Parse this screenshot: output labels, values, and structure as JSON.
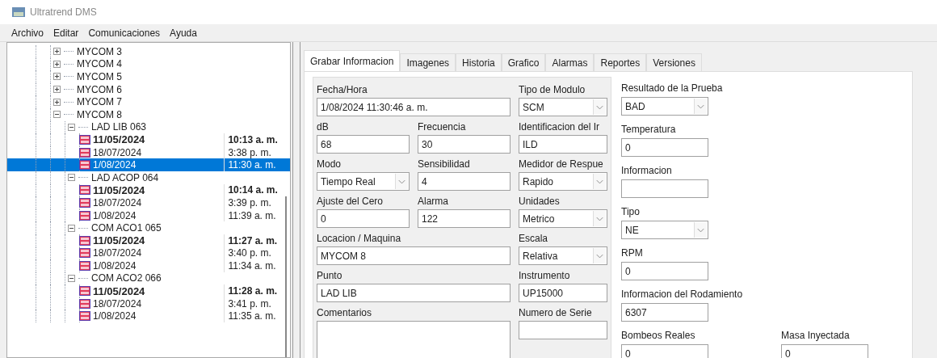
{
  "window": {
    "title": "Ultratrend DMS"
  },
  "menu": [
    "Archivo",
    "Editar",
    "Comunicaciones",
    "Ayuda"
  ],
  "tree": [
    {
      "label": "MYCOM 3",
      "expanded": false
    },
    {
      "label": "MYCOM 4",
      "expanded": false
    },
    {
      "label": "MYCOM 5",
      "expanded": false
    },
    {
      "label": "MYCOM 6",
      "expanded": false
    },
    {
      "label": "MYCOM 7",
      "expanded": false
    },
    {
      "label": "MYCOM 8",
      "expanded": true,
      "children": [
        {
          "label": "LAD LIB 063",
          "expanded": true,
          "readings": [
            {
              "date": "11/05/2024",
              "time": "10:13 a. m.",
              "bold": true,
              "selected": false
            },
            {
              "date": "18/07/2024",
              "time": "3:38 p. m.",
              "bold": false,
              "selected": false
            },
            {
              "date": "1/08/2024",
              "time": "11:30 a. m.",
              "bold": false,
              "selected": true
            }
          ]
        },
        {
          "label": "LAD ACOP 064",
          "expanded": true,
          "readings": [
            {
              "date": "11/05/2024",
              "time": "10:14 a. m.",
              "bold": true,
              "selected": false
            },
            {
              "date": "18/07/2024",
              "time": "3:39 p. m.",
              "bold": false,
              "selected": false
            },
            {
              "date": "1/08/2024",
              "time": "11:39 a. m.",
              "bold": false,
              "selected": false
            }
          ]
        },
        {
          "label": "COM ACO1 065",
          "expanded": true,
          "readings": [
            {
              "date": "11/05/2024",
              "time": "11:27 a. m.",
              "bold": true,
              "selected": false
            },
            {
              "date": "18/07/2024",
              "time": "3:40 p. m.",
              "bold": false,
              "selected": false
            },
            {
              "date": "1/08/2024",
              "time": "11:34 a. m.",
              "bold": false,
              "selected": false
            }
          ]
        },
        {
          "label": "COM ACO2 066",
          "expanded": true,
          "readings": [
            {
              "date": "11/05/2024",
              "time": "11:28 a. m.",
              "bold": true,
              "selected": false
            },
            {
              "date": "18/07/2024",
              "time": "3:41 p. m.",
              "bold": false,
              "selected": false
            },
            {
              "date": "1/08/2024",
              "time": "11:35 a. m.",
              "bold": false,
              "selected": false
            }
          ]
        }
      ]
    }
  ],
  "tabs": [
    {
      "label": "Grabar Informacion",
      "selected": true
    },
    {
      "label": "Imagenes",
      "selected": false
    },
    {
      "label": "Historia",
      "selected": false
    },
    {
      "label": "Grafico",
      "selected": false
    },
    {
      "label": "Alarmas",
      "selected": false
    },
    {
      "label": "Reportes",
      "selected": false
    },
    {
      "label": "Versiones",
      "selected": false
    }
  ],
  "form": [
    {
      "label": "Fecha/Hora",
      "value": "1/08/2024  11:30:46 a. m.",
      "kind": "text"
    },
    {
      "label": "Tipo de Modulo",
      "value": "SCM",
      "kind": "select"
    },
    {
      "label": "dB",
      "value": "68",
      "kind": "text"
    },
    {
      "label": "Frecuencia",
      "value": "30",
      "kind": "text"
    },
    {
      "label": "Identificacion del Ir",
      "value": "ILD",
      "kind": "text"
    },
    {
      "label": "Modo",
      "value": "Tiempo Real",
      "kind": "select"
    },
    {
      "label": "Sensibilidad",
      "value": "4",
      "kind": "text"
    },
    {
      "label": "Medidor de Respue",
      "value": "Rapido",
      "kind": "select"
    },
    {
      "label": "Ajuste del Cero",
      "value": "0",
      "kind": "text"
    },
    {
      "label": "Alarma",
      "value": "122",
      "kind": "text"
    },
    {
      "label": "Unidades",
      "value": "Metrico",
      "kind": "select"
    },
    {
      "label": "Locacion / Maquina",
      "value": "MYCOM 8",
      "kind": "text"
    },
    {
      "label": "Escala",
      "value": "Relativa",
      "kind": "select"
    },
    {
      "label": "Punto",
      "value": "LAD LIB",
      "kind": "text"
    },
    {
      "label": "Instrumento",
      "value": "UP15000",
      "kind": "text"
    },
    {
      "label": "Comentarios",
      "kind": "textarea"
    },
    {
      "label": "Numero de Serie",
      "kind": "text"
    }
  ],
  "side_form": [
    {
      "label": "Resultado de la Prueba",
      "value": "BAD",
      "kind": "select"
    },
    {
      "label": "Temperatura",
      "value": "0",
      "kind": "text"
    },
    {
      "label": "Informacion",
      "kind": "text"
    },
    {
      "label": "Tipo",
      "value": "NE",
      "kind": "select"
    },
    {
      "label": "RPM",
      "value": "0",
      "kind": "text"
    },
    {
      "label": "Informacion del Rodamiento",
      "value": "6307",
      "kind": "text"
    },
    {
      "label": "Bombeos Reales",
      "value": "0",
      "kind": "text"
    },
    {
      "label": "Masa Inyectada",
      "value": "0",
      "kind": "text"
    }
  ]
}
